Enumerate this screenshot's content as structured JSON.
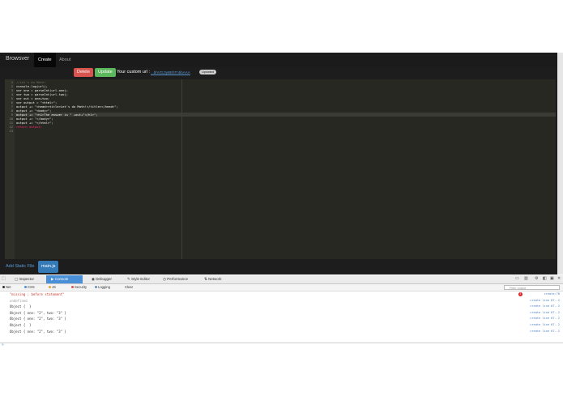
{
  "navbar": {
    "brand": "Browsver",
    "items": [
      "Create",
      "About"
    ]
  },
  "toolbar": {
    "delete_label": "Delete",
    "update_label": "Update",
    "custom_url_label": "Your custom url :",
    "custom_url": "...bhVGJIyBEbTnbbAAA",
    "badge": "Updated"
  },
  "editor": {
    "line_numbers": [
      "1",
      "2",
      "3",
      "4",
      "5",
      "6",
      "7",
      "8",
      "9",
      "10",
      "11",
      "12",
      "13"
    ],
    "lines": [
      "//Let's do Math!",
      "console.log(url);",
      "var one = parseInt(url.one);",
      "var two = parseInt(url.two);",
      "var out = one+two;",
      "var output = \"<html>\";",
      "output += \"<head><title>Let's do Math!</title></head>\";",
      "output += \"<body>\";",
      "output += \"<h1>The answer is \" +out+\"</h1>\";",
      "output += \"</body>\";",
      "output += \"</html>\";",
      "return output;",
      ""
    ],
    "current_line": 8
  },
  "files": {
    "add_label": "Add Static File",
    "tabs": [
      "main.js"
    ]
  },
  "devtools": {
    "tabs": [
      "Inspector",
      "Console",
      "Debugger",
      "Style Editor",
      "Performance",
      "Network"
    ],
    "active_tab": "Console",
    "filters": [
      "Net",
      "CSS",
      "JS",
      "Security",
      "Logging",
      "Clear"
    ],
    "filter_placeholder": "Filter output",
    "colors": {
      "net": "#333333",
      "css": "#4a90d9",
      "js": "#e8a33a",
      "security": "#d9534f",
      "logging": "#6b8fb5"
    },
    "messages": [
      {
        "text": "\"missing ; before statement\"",
        "source": "create:78",
        "type": "error"
      },
      {
        "text": "undefined",
        "source": "create line 67..2",
        "type": "log"
      },
      {
        "text": "Object {  }",
        "source": "create line 67..2",
        "type": "log"
      },
      {
        "text": "Object { one: \"2\", two: \"3\" }",
        "source": "create line 67..2",
        "type": "log"
      },
      {
        "text": "Object { one: \"2\", two: \"3\" }",
        "source": "create line 67..2",
        "type": "log"
      },
      {
        "text": "Object {  }",
        "source": "create line 67..2",
        "type": "log"
      },
      {
        "text": "Object { one: \"2\", two: \"3\" }",
        "source": "create line 67..2",
        "type": "log"
      }
    ],
    "error_count": "1",
    "prompt": "»"
  }
}
